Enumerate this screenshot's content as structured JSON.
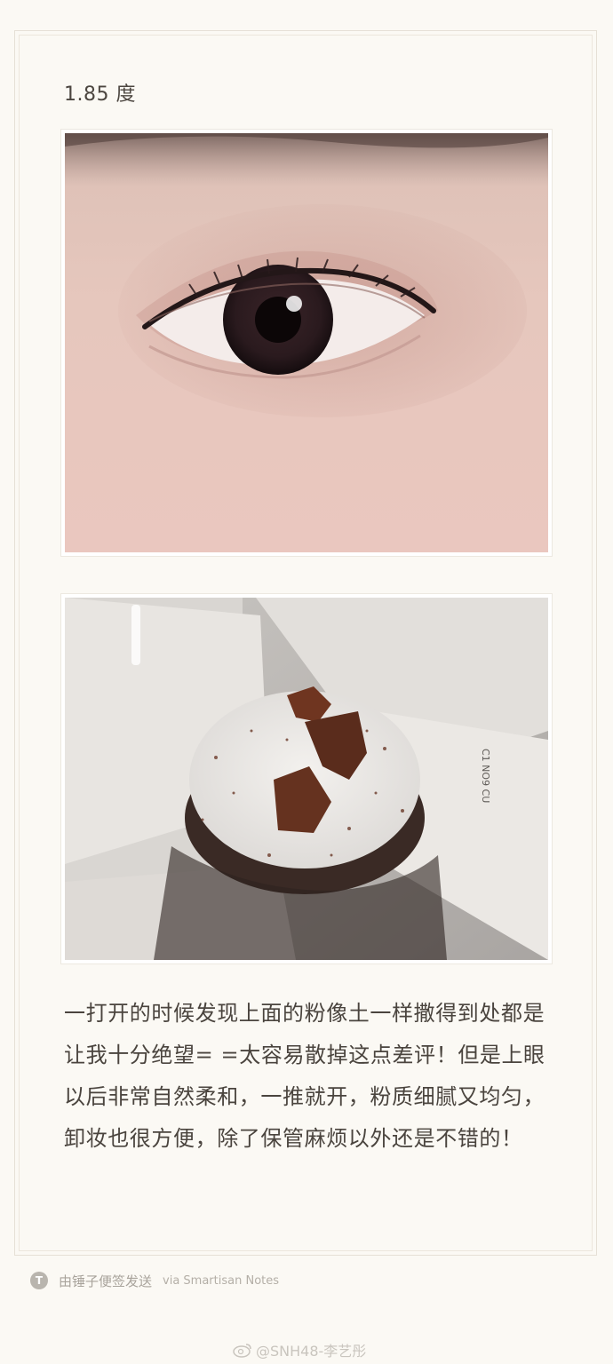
{
  "note": {
    "heading": "1.85 度",
    "body": "一打开的时候发现上面的粉像土一样撒得到处都是让我十分绝望= =太容易散掉这点差评！但是上眼以后非常自然柔和，一推就开，粉质细腻又均匀，卸妆也很方便，除了保管麻烦以外还是不错的！"
  },
  "footer": {
    "badge": "T",
    "sent_by": "由锤子便签发送",
    "via": "via Smartisan Notes"
  },
  "watermark": {
    "text": "@SNH48-李艺彤"
  }
}
